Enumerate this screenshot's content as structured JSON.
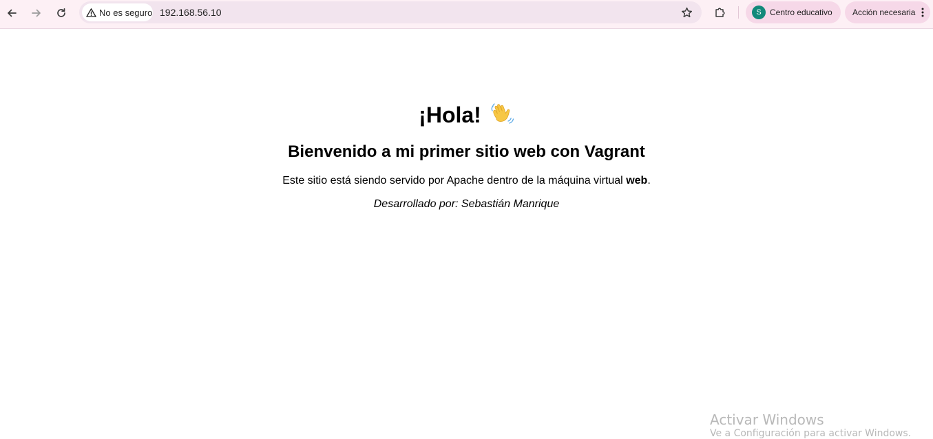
{
  "browser": {
    "security_label": "No es seguro",
    "url": "192.168.56.10",
    "profile": {
      "initial": "S",
      "label": "Centro educativo",
      "avatar_color": "#12897a"
    },
    "action_label": "Acción necesaria",
    "icons": [
      "back-arrow-icon",
      "forward-arrow-icon",
      "reload-icon",
      "warning-icon",
      "star-icon",
      "extensions-puzzle-icon",
      "kebab-menu-icon"
    ]
  },
  "page": {
    "heading": "¡Hola!",
    "heading_emoji": "waving-hand-emoji",
    "subheading": "Bienvenido a mi primer sitio web con Vagrant",
    "paragraph_before": "Este sitio está siendo servido por Apache dentro de la máquina virtual ",
    "paragraph_bold": "web",
    "paragraph_after": ".",
    "credit": "Desarrollado por: Sebastián Manrique"
  },
  "watermark": {
    "title": "Activar Windows",
    "subtitle": "Ve a Configuración para activar Windows."
  }
}
